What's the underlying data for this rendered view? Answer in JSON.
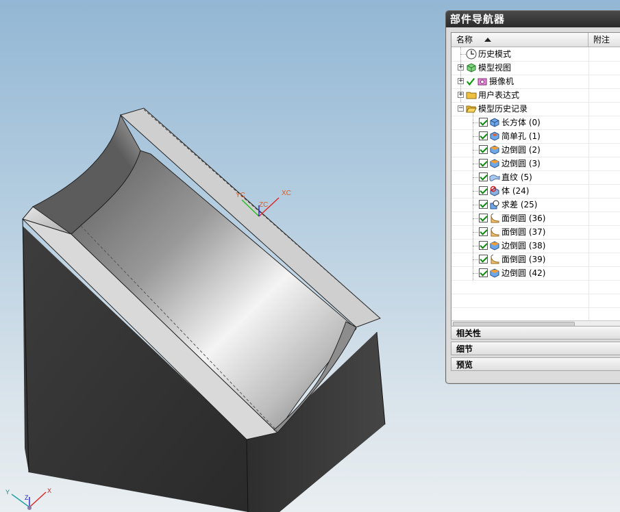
{
  "viewport": {
    "background_top": "#93b7d4",
    "background_bottom": "#e9eef1",
    "wcs_labels": {
      "xc": "XC",
      "yc": "YC",
      "zc": "ZC"
    },
    "triad_labels": {
      "x": "X",
      "y": "Y",
      "z": "Z"
    },
    "axis_colors": {
      "x": "#e02020",
      "y": "#20c020",
      "z": "#2020e0"
    }
  },
  "navigator": {
    "title": "部件导航器",
    "columns": {
      "name": "名称",
      "note": "附注"
    },
    "tree": [
      {
        "label": "历史模式",
        "icon": "clock-icon",
        "expander": ""
      },
      {
        "label": "模型视图",
        "icon": "model-view-icon",
        "expander": "+"
      },
      {
        "label": "摄像机",
        "icon": "camera-icon",
        "expander": "+"
      },
      {
        "label": "用户表达式",
        "icon": "folder-icon",
        "expander": "+"
      },
      {
        "label": "模型历史记录",
        "icon": "folder-open-icon",
        "expander": "−"
      }
    ],
    "features": [
      {
        "label": "长方体 (0)",
        "icon": "block-icon"
      },
      {
        "label": "简单孔 (1)",
        "icon": "hole-icon"
      },
      {
        "label": "边倒圆 (2)",
        "icon": "edge-blend-icon"
      },
      {
        "label": "边倒圆 (3)",
        "icon": "edge-blend-icon"
      },
      {
        "label": "直纹 (5)",
        "icon": "ruled-icon"
      },
      {
        "label": "体 (24)",
        "icon": "body-icon"
      },
      {
        "label": "求差 (25)",
        "icon": "subtract-icon"
      },
      {
        "label": "面倒圆 (36)",
        "icon": "face-blend-icon"
      },
      {
        "label": "面倒圆 (37)",
        "icon": "face-blend-icon"
      },
      {
        "label": "边倒圆 (38)",
        "icon": "edge-blend-icon"
      },
      {
        "label": "面倒圆 (39)",
        "icon": "face-blend-icon"
      },
      {
        "label": "边倒圆 (42)",
        "icon": "edge-blend-icon"
      }
    ],
    "sections": [
      "相关性",
      "细节",
      "预览"
    ]
  }
}
